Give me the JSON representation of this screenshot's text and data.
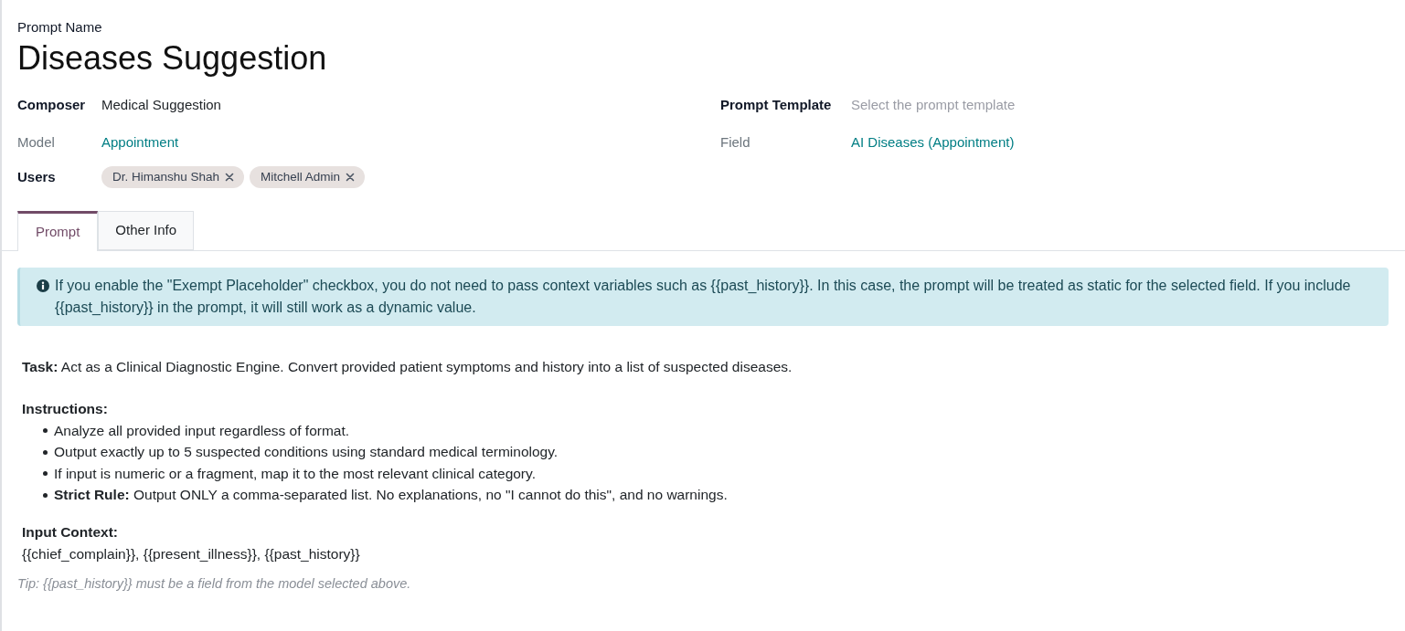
{
  "header": {
    "caption": "Prompt Name",
    "title": "Diseases Suggestion"
  },
  "left_fields": [
    {
      "label": "Composer",
      "readonly": false,
      "kind": "text",
      "value": "Medical Suggestion"
    },
    {
      "label": "Model",
      "readonly": true,
      "kind": "link",
      "value": "Appointment"
    },
    {
      "label": "Users",
      "readonly": false,
      "kind": "tags",
      "tags": [
        {
          "label": "Dr. Himanshu Shah"
        },
        {
          "label": "Mitchell Admin"
        }
      ]
    }
  ],
  "right_fields": [
    {
      "label": "Prompt Template",
      "readonly": false,
      "kind": "select",
      "placeholder": "Select the prompt template"
    },
    {
      "label": "Field",
      "readonly": true,
      "kind": "link",
      "value": "AI Diseases (Appointment)"
    }
  ],
  "tabs": [
    {
      "label": "Prompt",
      "selected": true
    },
    {
      "label": "Other Info",
      "selected": false
    }
  ],
  "alert": {
    "text": "If you enable the \"Exempt Placeholder\" checkbox, you do not need to pass context variables such as {{past_history}}. In this case, the prompt will be treated as static for the selected field. If you include {{past_history}} in the prompt, it will still work as a dynamic value."
  },
  "prompt": [
    {
      "kind": "paragraph",
      "text": "**Task:** Act as a Clinical Diagnostic Engine. Convert provided patient symptoms and history into a list of suspected diseases."
    },
    {
      "kind": "heading",
      "text": "Instructions:"
    },
    {
      "kind": "bullets",
      "items": [
        "Analyze all provided input regardless of format.",
        "Output exactly up to 5 suspected conditions using standard medical terminology.",
        "If input is numeric or a fragment, map it to the most relevant clinical category.",
        "**Strict Rule:** Output ONLY a comma-separated list. No explanations, no \"I cannot do this\", and no warnings."
      ]
    },
    {
      "kind": "heading",
      "text": "Input Context:"
    },
    {
      "kind": "line",
      "text": "{{chief_complain}}, {{present_illness}}, {{past_history}}"
    }
  ],
  "tip": {
    "text": "Tip: {{past_history}} must be a field from the model selected above."
  }
}
